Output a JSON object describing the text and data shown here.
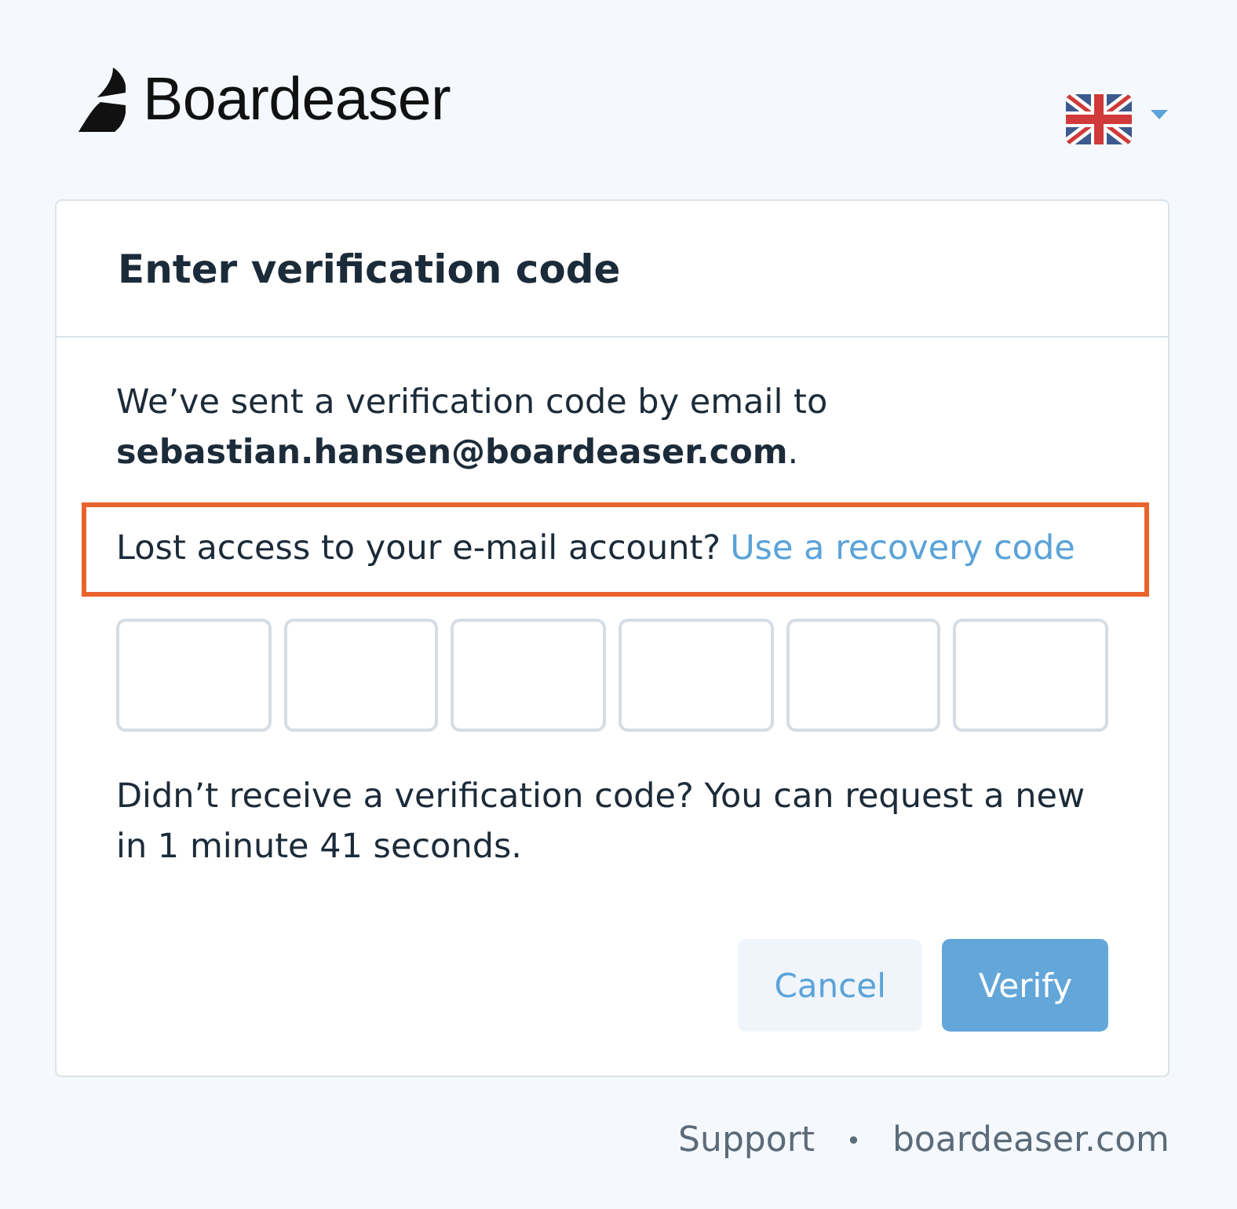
{
  "header": {
    "logo": {
      "name": "Boardeaser"
    },
    "language_selector": {
      "expanded": false
    }
  },
  "card": {
    "title": "Enter verification code",
    "message": "We’ve sent a verification code by email to **sebastian.hansen@boardeaser.com**.",
    "recovery": {
      "highlighted": true,
      "question": "Lost access to your e-mail account?",
      "link": "Use a recovery code"
    },
    "code_fields": [
      {
        "focused": false
      },
      {
        "focused": false
      },
      {
        "focused": false
      },
      {
        "focused": false
      },
      {
        "focused": false
      },
      {
        "focused": false
      }
    ],
    "resend_notice": "Didn’t receive a verification code? You can request a new in 1 minute 41 seconds.",
    "buttons": [
      {
        "label": "Cancel",
        "kind": "secondary"
      },
      {
        "label": "Verify",
        "kind": "primary"
      }
    ]
  },
  "footer": {
    "links": [
      "Support",
      "boardeaser.com"
    ],
    "separator": "•"
  }
}
